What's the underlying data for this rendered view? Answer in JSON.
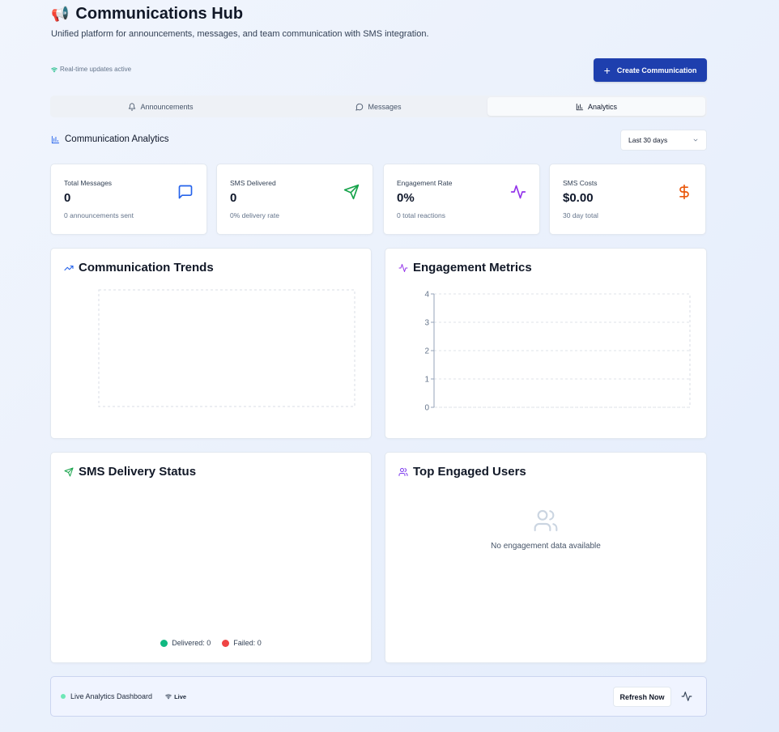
{
  "header": {
    "emoji": "📢",
    "title": "Communications Hub",
    "subtitle": "Unified platform for announcements, messages, and team communication with SMS integration.",
    "realtime_status": "Real-time updates active",
    "create_button_label": "Create Communication"
  },
  "tabs": [
    {
      "label": "Announcements",
      "icon": "bell-icon"
    },
    {
      "label": "Messages",
      "icon": "message-icon"
    },
    {
      "label": "Analytics",
      "icon": "bar-chart-icon",
      "active": true
    }
  ],
  "analytics": {
    "heading": "Communication Analytics",
    "range_selected": "Last 30 days"
  },
  "stats": [
    {
      "label": "Total Messages",
      "value": "0",
      "sub": "0 announcements sent",
      "icon": "message-square-icon",
      "color": "#2563eb"
    },
    {
      "label": "SMS Delivered",
      "value": "0",
      "sub": "0% delivery rate",
      "icon": "send-icon",
      "color": "#16a34a"
    },
    {
      "label": "Engagement Rate",
      "value": "0%",
      "sub": "0 total reactions",
      "icon": "activity-icon",
      "color": "#9333ea"
    },
    {
      "label": "SMS Costs",
      "value": "$0.00",
      "sub": "30 day total",
      "icon": "dollar-icon",
      "color": "#ea580c"
    }
  ],
  "panels": {
    "trends_title": "Communication Trends",
    "engagement_title": "Engagement Metrics",
    "sms_title": "SMS Delivery Status",
    "users_title": "Top Engaged Users",
    "users_empty": "No engagement data available",
    "legend_delivered": "Delivered: 0",
    "legend_failed": "Failed: 0"
  },
  "chart_data": [
    {
      "type": "line",
      "title": "Communication Trends",
      "series": [],
      "grid": true
    },
    {
      "type": "bar",
      "title": "Engagement Metrics",
      "series": [],
      "ylim": [
        0,
        4
      ],
      "yticks": [
        "0",
        "1",
        "2",
        "3",
        "4"
      ],
      "grid": true
    },
    {
      "type": "pie",
      "title": "SMS Delivery Status",
      "series": [
        {
          "name": "Delivered",
          "values": [
            0
          ]
        },
        {
          "name": "Failed",
          "values": [
            0
          ]
        }
      ],
      "legend": "bottom"
    }
  ],
  "colors": {
    "accent": "#1e3fae",
    "delivered": "#10b981",
    "failed": "#ef4444",
    "live_dot": "#6ee7b7"
  },
  "footer": {
    "label": "Live Analytics Dashboard",
    "live_badge": "Live",
    "refresh_label": "Refresh Now"
  }
}
